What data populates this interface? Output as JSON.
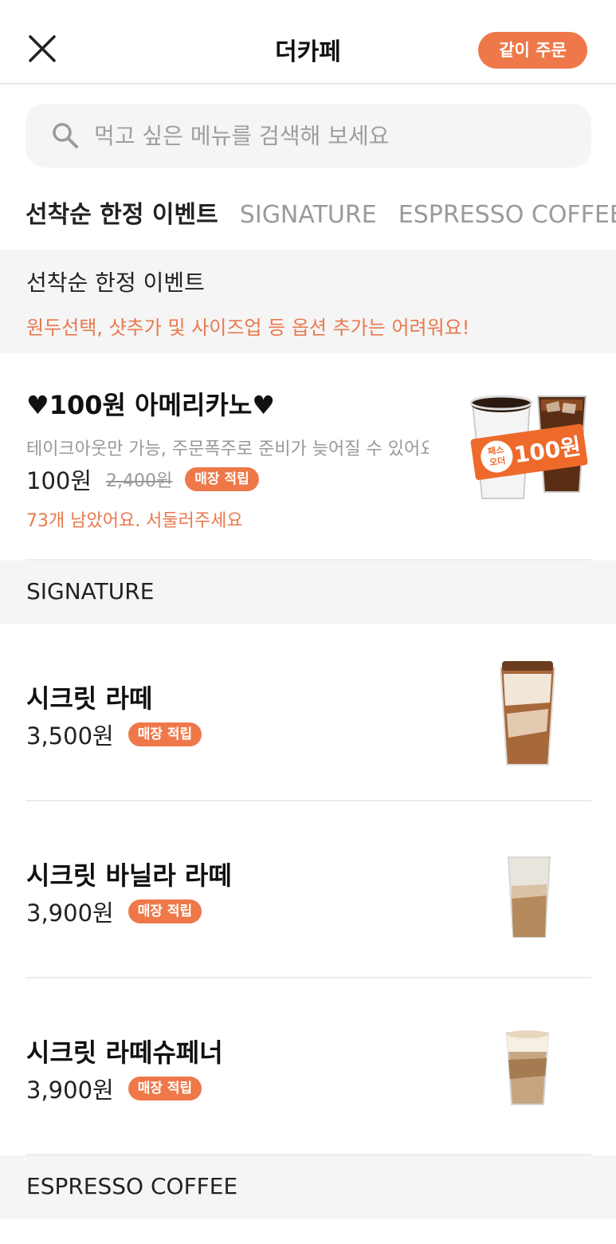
{
  "header": {
    "title": "더카페",
    "close_icon": "close-icon",
    "group_order_label": "같이 주문"
  },
  "search": {
    "placeholder": "먹고 싶은 메뉴를 검색해 보세요",
    "icon": "search-icon"
  },
  "tabs": [
    {
      "label": "선착순 한정 이벤트",
      "active": true
    },
    {
      "label": "SIGNATURE",
      "active": false
    },
    {
      "label": "ESPRESSO COFFEE",
      "active": false
    }
  ],
  "sections": {
    "event": {
      "title": "선착순 한정 이벤트",
      "notice": "원두선택, 샷추가 및 사이즈업 등 옵션 추가는 어려워요!",
      "items": [
        {
          "name": "♥100원 아메리카노♥",
          "description": "테이크아웃만 가능, 주문폭주로 준비가 늦어질 수 있어요",
          "price": "100원",
          "original_price": "2,400원",
          "badge": "매장 적립",
          "stock_text": "73개 남았어요. 서둘러주세요",
          "image_tag_line1": "패스",
          "image_tag_line2": "오더",
          "image_tag_price": "100원"
        }
      ]
    },
    "signature": {
      "title": "SIGNATURE",
      "items": [
        {
          "name": "시크릿 라떼",
          "price": "3,500원",
          "badge": "매장 적립"
        },
        {
          "name": "시크릿 바닐라 라떼",
          "price": "3,900원",
          "badge": "매장 적립"
        },
        {
          "name": "시크릿 라떼슈페너",
          "price": "3,900원",
          "badge": "매장 적립"
        }
      ]
    },
    "espresso": {
      "title": "ESPRESSO COFFEE"
    }
  },
  "colors": {
    "accent": "#ee7849",
    "section_bg": "#f5f5f5"
  }
}
